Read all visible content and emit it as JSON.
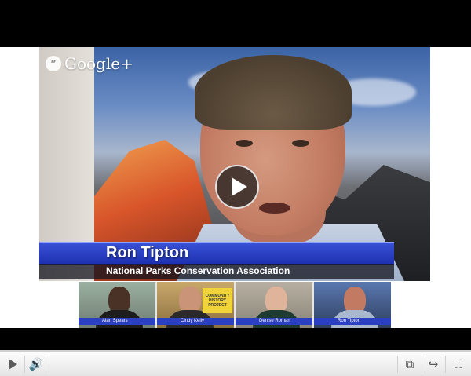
{
  "overlay": {
    "brand": "Google+",
    "hangout_glyph": "”",
    "name": "Ron Tipton",
    "organization": "National Parks Conservation Association"
  },
  "participants": [
    {
      "name": "Alan Spears"
    },
    {
      "name": "Cindy Kelly",
      "sign_text": "COMMUNITY HISTORY PROJECT"
    },
    {
      "name": "Denise Roman"
    },
    {
      "name": "Ron Tipton"
    }
  ],
  "controls": {
    "play_icon": "play-icon",
    "volume_icon": "speaker-icon",
    "volume_glyph": "🔊",
    "popout_icon": "popout-icon",
    "popout_glyph": "⧉",
    "share_icon": "share-icon",
    "share_glyph": "↪",
    "fullscreen_icon": "fullscreen-icon",
    "fullscreen_glyph": "⛶"
  },
  "progress": {
    "fraction": 0.0
  },
  "colors": {
    "lower_third": "#2338c4",
    "progress": "#cc181e"
  }
}
